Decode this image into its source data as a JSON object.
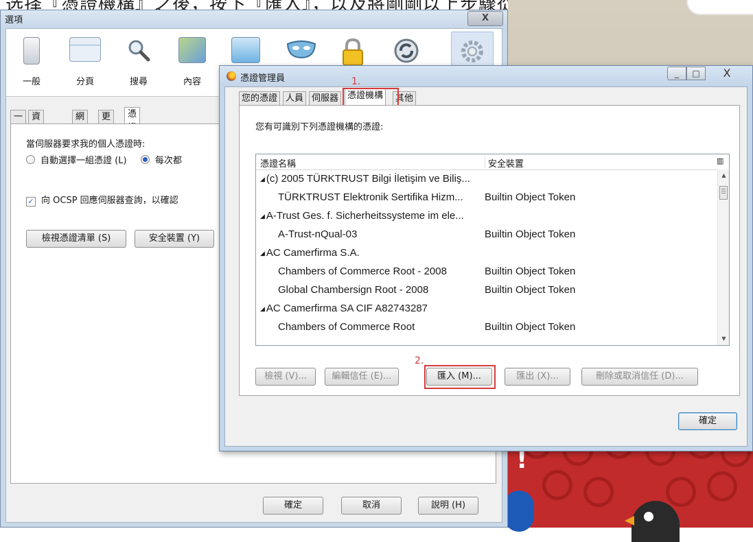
{
  "background": {
    "top_text": "选择『憑證機構』之後，按下『匯入』，以及將剛剛以上步驟從伺服器所匯出的憑證"
  },
  "options_window": {
    "title": "選項",
    "close_label": "X",
    "toolbar": [
      {
        "label": "一般",
        "icon": "general-icon"
      },
      {
        "label": "分頁",
        "icon": "tabs-icon"
      },
      {
        "label": "搜尋",
        "icon": "search-icon"
      },
      {
        "label": "內容",
        "icon": "content-icon"
      },
      {
        "label": "",
        "icon": "applications-icon"
      },
      {
        "label": "",
        "icon": "privacy-mask-icon"
      },
      {
        "label": "",
        "icon": "security-lock-icon"
      },
      {
        "label": "",
        "icon": "sync-icon"
      },
      {
        "label": "",
        "icon": "advanced-gear-icon"
      }
    ],
    "tabs": [
      "一般",
      "資料選擇",
      "網路",
      "更新",
      "憑證"
    ],
    "active_tab": "憑證",
    "prompt": "當伺服器要求我的個人憑證時:",
    "radio_auto": "自動選擇一組憑證 (L)",
    "radio_ask": "每次都",
    "ocsp": "向 OCSP 回應伺服器查詢，以確認",
    "view_certs_button": "檢視憑證清單 (S)",
    "security_devices_button": "安全裝置 (Y)",
    "ok_button": "確定",
    "cancel_button": "取消",
    "help_button": "說明 (H)"
  },
  "cert_manager": {
    "title": "憑證管理員",
    "tabs": [
      "您的憑證",
      "人員",
      "伺服器",
      "憑證機構",
      "其他"
    ],
    "active_tab": "憑證機構",
    "annotation_1": "1.",
    "annotation_2": "2.",
    "description": "您有可識別下列憑證機構的憑證:",
    "columns": [
      "憑證名稱",
      "安全裝置"
    ],
    "rows": [
      {
        "name": "(c) 2005 TÜRKTRUST Bilgi İletişim ve Biliş...",
        "device": "",
        "group": true
      },
      {
        "name": "TÜRKTRUST Elektronik Sertifika Hizm...",
        "device": "Builtin Object Token",
        "group": false
      },
      {
        "name": "A-Trust Ges. f. Sicherheitssysteme im ele...",
        "device": "",
        "group": true
      },
      {
        "name": "A-Trust-nQual-03",
        "device": "Builtin Object Token",
        "group": false
      },
      {
        "name": "AC Camerfirma S.A.",
        "device": "",
        "group": true
      },
      {
        "name": "Chambers of Commerce Root - 2008",
        "device": "Builtin Object Token",
        "group": false
      },
      {
        "name": "Global Chambersign Root - 2008",
        "device": "Builtin Object Token",
        "group": false
      },
      {
        "name": "AC Camerfirma SA CIF A82743287",
        "device": "",
        "group": true
      },
      {
        "name": "Chambers of Commerce Root",
        "device": "Builtin Object Token",
        "group": false
      }
    ],
    "buttons": {
      "view": "檢視 (V)...",
      "edit_trust": "編輯信任 (E)...",
      "import": "匯入 (M)...",
      "export": "匯出 (X)...",
      "delete": "刪除或取消信任 (D)..."
    },
    "ok_button": "確定",
    "minimize_label": "_",
    "maximize_label": "□",
    "close_label": "X"
  },
  "colors": {
    "highlight_red": "#d43a3a",
    "window_frame": "#c4d6ea",
    "game_red": "#c22b2b"
  }
}
